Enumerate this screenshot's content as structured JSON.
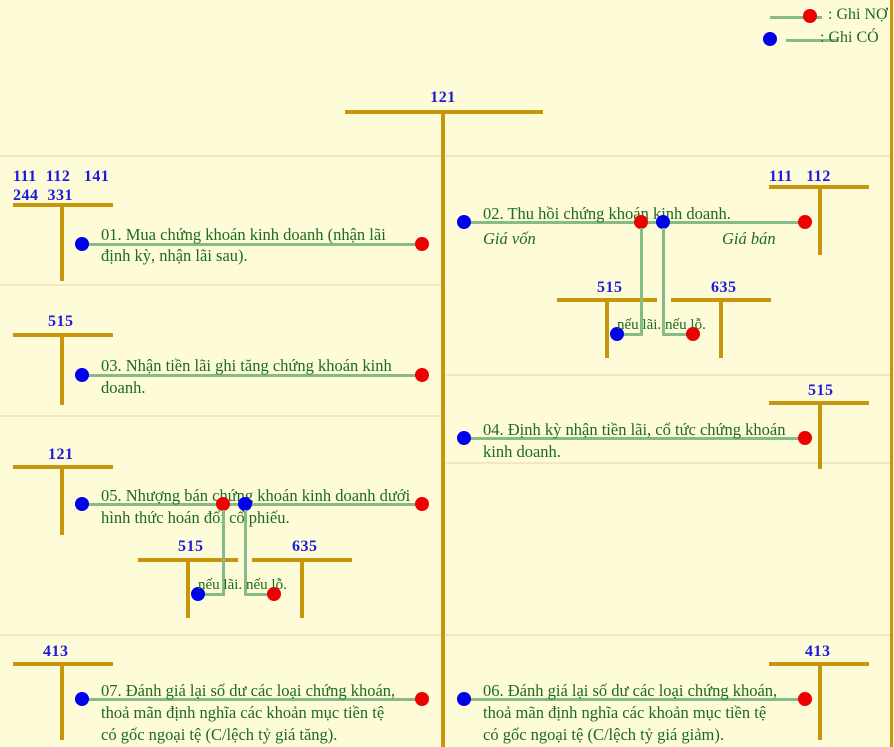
{
  "legend": {
    "debit": ": Ghi NỢ",
    "credit": ": Ghi CÓ"
  },
  "central_account": {
    "code": "121"
  },
  "entries": [
    {
      "id": "01",
      "text_line1": "01. Mua chứng khoán kinh doanh (nhận lãi",
      "text_line2": "định kỳ, nhận lãi sau).",
      "accounts_row1": [
        "111",
        "112",
        "141"
      ],
      "accounts_row2": [
        "244",
        "331"
      ]
    },
    {
      "id": "02",
      "text_line1": "02. Thu hồi chứng khoán kinh doanh.",
      "label_left": "Giá vốn",
      "label_right": "Giá bán",
      "accounts": [
        "111",
        "112"
      ],
      "sub_left_account": "515",
      "sub_right_account": "635",
      "sub_left_label": "nếu lãi.",
      "sub_right_label": "nếu lỗ."
    },
    {
      "id": "03",
      "text_line1": "03. Nhận tiền lãi ghi tăng chứng khoán kinh",
      "text_line2": "doanh.",
      "accounts": [
        "515"
      ]
    },
    {
      "id": "04",
      "text_line1": "04. Định kỳ nhận tiền lãi, cổ tức chứng khoán",
      "text_line2": "kinh doanh.",
      "accounts": [
        "515"
      ]
    },
    {
      "id": "05",
      "text_line1": "05. Nhượng bán chứng khoán kinh doanh dưới",
      "text_line2": "hình thức hoán đổi cổ phiếu.",
      "accounts": [
        "121"
      ],
      "sub_left_account": "515",
      "sub_right_account": "635",
      "sub_left_label": "nếu lãi.",
      "sub_right_label": "nếu lỗ."
    },
    {
      "id": "06",
      "text_line1": "06. Đánh giá lại số dư các loại chứng khoán,",
      "text_line2": "thoả mãn định nghĩa các khoản mục tiền tệ",
      "text_line3": "có gốc ngoại tệ (C/lệch tỷ giá giảm).",
      "accounts": [
        "413"
      ]
    },
    {
      "id": "07",
      "text_line1": "07. Đánh giá lại số dư các loại chứng khoán,",
      "text_line2": "thoả mãn định nghĩa các khoản mục tiền tệ",
      "text_line3": "có gốc ngoại tệ (C/lệch tỷ giá tăng).",
      "accounts": [
        "413"
      ]
    }
  ],
  "colors": {
    "background": "#fdfbd8",
    "taccount": "#c8960c",
    "flow_line": "#86bb86",
    "debit_dot": "#ee0000",
    "credit_dot": "#0000ee",
    "account_code": "#1a1ae0",
    "entry_text": "#1d6b1d"
  }
}
